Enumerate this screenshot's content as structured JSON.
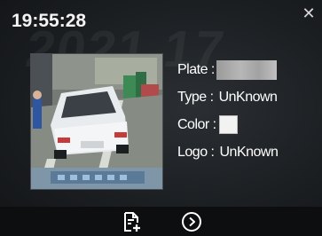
{
  "popup": {
    "timestamp": "19:55:28",
    "close_glyph": "✕"
  },
  "details": {
    "plate_label": "Plate :",
    "type_label": "Type :",
    "type_value": "UnKnown",
    "color_label": "Color :",
    "color_value_hex": "#f2f2f2",
    "logo_label": "Logo :",
    "logo_value": "UnKnown"
  },
  "toolbar": {
    "icons": [
      "export-icon",
      "play-icon"
    ]
  },
  "colors": {
    "background": "#1c1f22",
    "toolbar": "#0d0e10",
    "text": "#ffffff"
  }
}
